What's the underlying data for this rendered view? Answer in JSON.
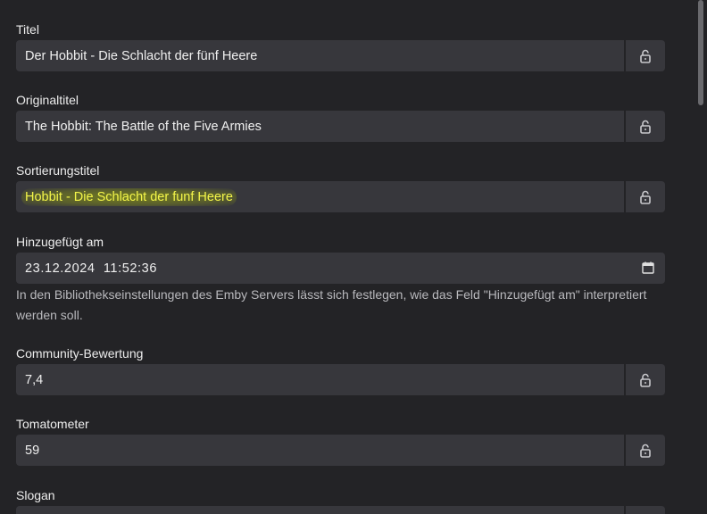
{
  "fields": {
    "title": {
      "label": "Titel",
      "value": "Der Hobbit - Die Schlacht der fünf Heere"
    },
    "original_title": {
      "label": "Originaltitel",
      "value": "The Hobbit: The Battle of the Five Armies"
    },
    "sort_title": {
      "label": "Sortierungstitel",
      "value": "Hobbit - Die Schlacht der funf Heere"
    },
    "date_added": {
      "label": "Hinzugefügt am",
      "value": "23.12.2024  11:52:36",
      "help": "In den Bibliothekseinstellungen des Emby Servers lässt sich festlegen, wie das Feld \"Hinzugefügt am\" interpretiert werden soll."
    },
    "community_rating": {
      "label": "Community-Bewertung",
      "value": "7,4"
    },
    "tomatometer": {
      "label": "Tomatometer",
      "value": "59"
    },
    "slogan": {
      "label": "Slogan",
      "value": ""
    }
  },
  "icons": {
    "lock": "lock-open-icon",
    "calendar": "calendar-icon"
  },
  "colors": {
    "background": "#232326",
    "input_background": "#37373c",
    "highlight": "#f3f54a"
  }
}
